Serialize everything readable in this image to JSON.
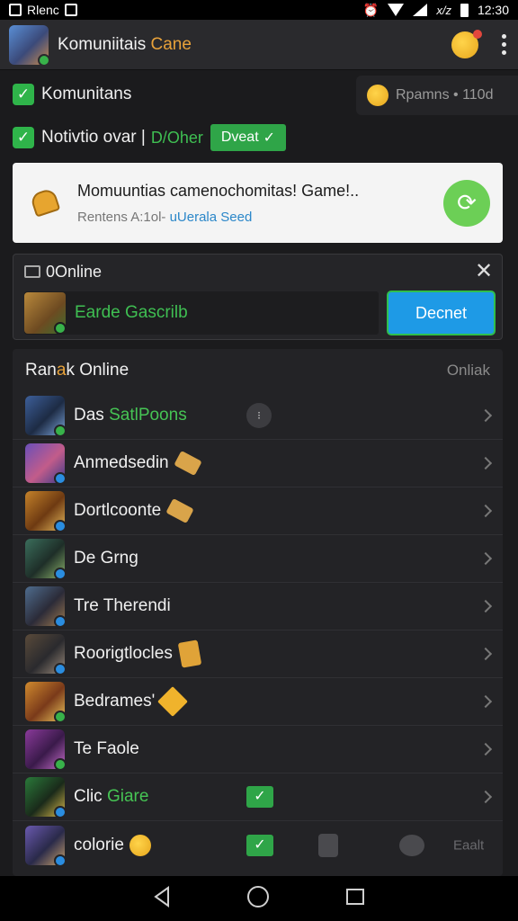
{
  "status_bar": {
    "left_text": "Rlenc",
    "time": "12:30",
    "mid_text": "x/z"
  },
  "app_bar": {
    "title_main": "Komuniitais ",
    "title_accent": "Cane"
  },
  "checkbox_row1": {
    "label": "Komunitans",
    "status_text": "Rpamns • 110d"
  },
  "checkbox_row2": {
    "label": "Notivtio ovar |",
    "sub_label": "D/Oher",
    "button_label": "Dveat"
  },
  "notification": {
    "title": "Momuuntias camenochomitas! Game!..",
    "subtitle_prefix": "Rentens A:1ol- ",
    "subtitle_link": "uUerala Seed"
  },
  "online_panel": {
    "title": "0Online",
    "field_value": "Earde Gascrilb",
    "button_label": "Decnet"
  },
  "list": {
    "header_prefix": "Ran",
    "header_accent": "a",
    "header_suffix": "k Online",
    "header_right": "Onliak",
    "items": [
      {
        "name": "Das ",
        "name_green": "SatlPoons"
      },
      {
        "name": "Anmedsedin",
        "name_green": ""
      },
      {
        "name": "Dortlcoonte",
        "name_green": ""
      },
      {
        "name": "De Grng",
        "name_green": ""
      },
      {
        "name": "Tre Therendi",
        "name_green": ""
      },
      {
        "name": "Roorigtlocles",
        "name_green": ""
      },
      {
        "name": "Bedrames'",
        "name_green": ""
      },
      {
        "name": "Te Faole",
        "name_green": ""
      },
      {
        "name": "Clic ",
        "name_green": "Giare"
      },
      {
        "name": "colorie",
        "name_green": ""
      }
    ],
    "ghost_text": "Eaalt"
  },
  "colors": {
    "accent_green": "#2fb44a",
    "accent_blue": "#1e9ae6",
    "accent_orange": "#e8a23a"
  },
  "icons": [
    "checkbox-icon",
    "bell-icon",
    "refresh-icon",
    "close-icon",
    "chevron-right-icon",
    "back-icon",
    "home-icon",
    "recents-icon"
  ]
}
